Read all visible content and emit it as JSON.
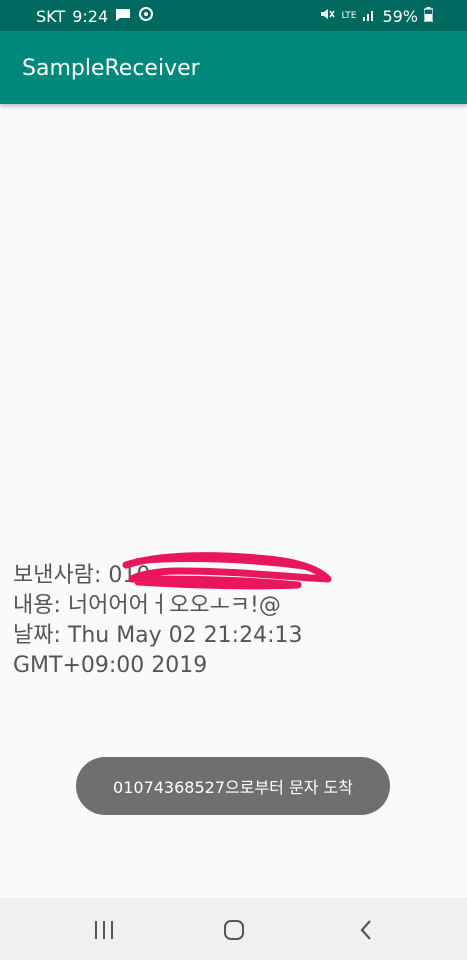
{
  "status_bar": {
    "carrier": "SKT",
    "time": "9:24",
    "network": "LTE",
    "battery": "59%",
    "icons": [
      "message-icon",
      "sync-icon",
      "mute-icon",
      "lte-icon",
      "signal-icon",
      "battery-icon"
    ]
  },
  "app_bar": {
    "title": "SampleReceiver"
  },
  "message": {
    "sender_label": "보낸사람: 010",
    "content_label": "내용: 너어어어ㅓ오오ㅗㅋ!@",
    "date_line1": "날짜: Thu May 02 21:24:13",
    "date_line2": "GMT+09:00 2019"
  },
  "toast": {
    "text": "01074368527으로부터 문자 도착"
  },
  "nav_bar": {
    "icons": [
      "recents-icon",
      "home-icon",
      "back-icon"
    ]
  },
  "colors": {
    "status_bar": "#00695f",
    "app_bar": "#00897b",
    "redaction": "#e8175d",
    "toast": "#6f6f6f"
  }
}
